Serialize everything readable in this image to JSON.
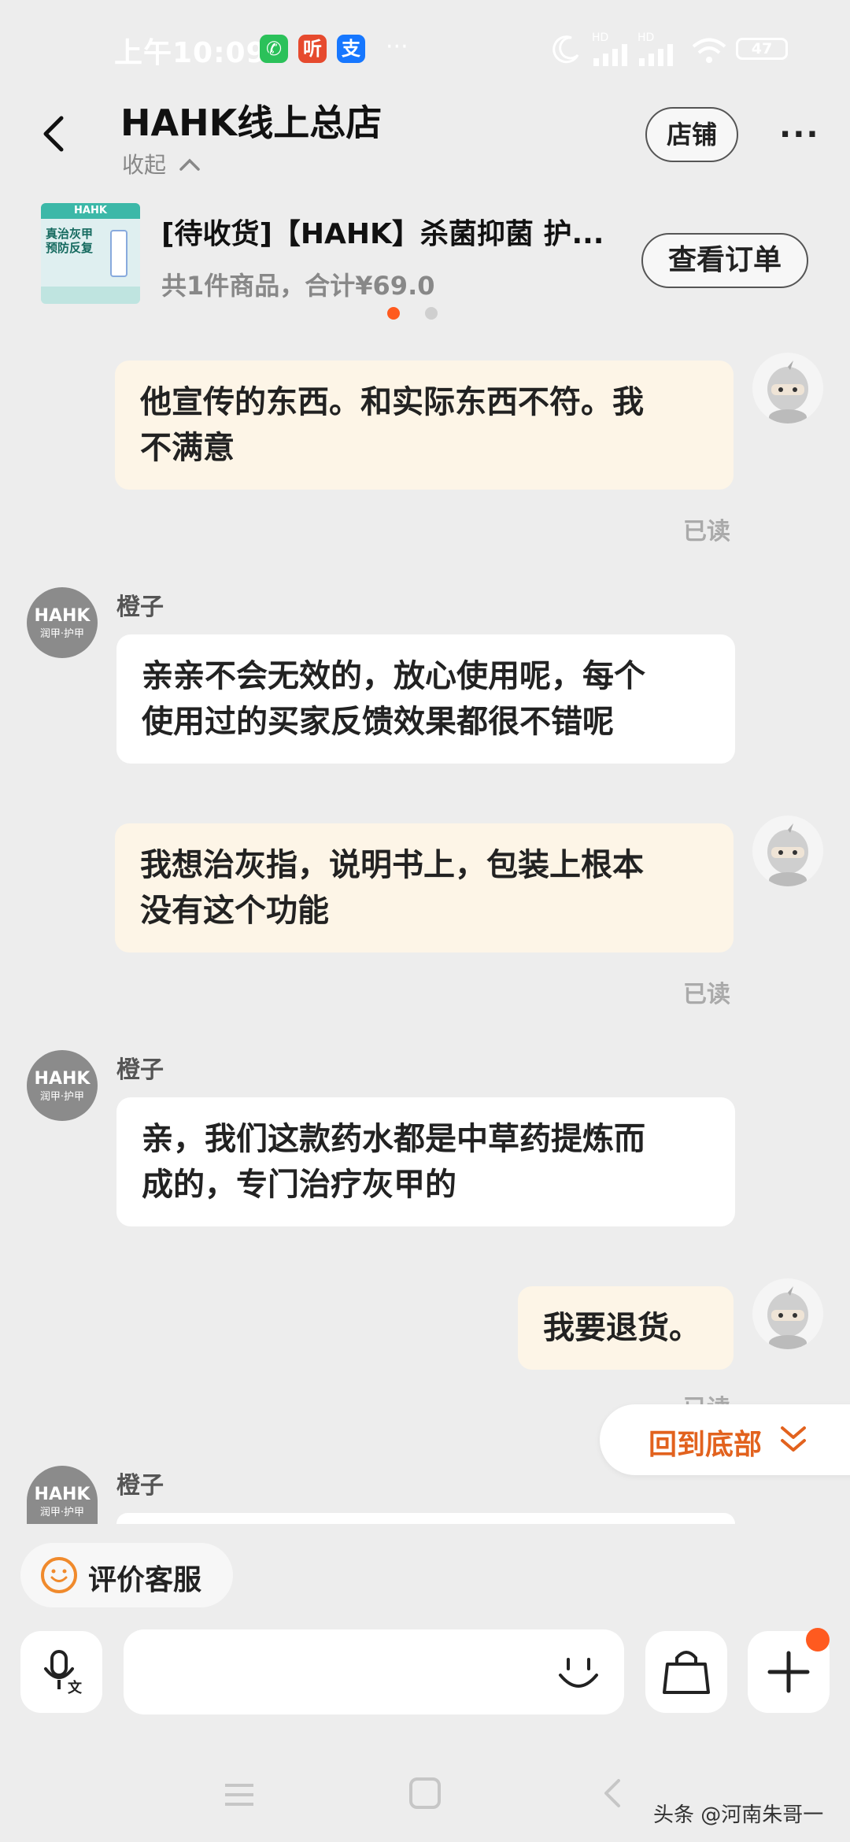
{
  "status_bar": {
    "time": "上午10:09",
    "apps": [
      {
        "name": "wechat",
        "glyph": "✆",
        "color": "#2bc15a"
      },
      {
        "name": "ting",
        "glyph": "听",
        "color": "#e64a2e"
      },
      {
        "name": "alipay",
        "glyph": "支",
        "color": "#1677ff"
      }
    ],
    "more": "···",
    "signal_1": "HD",
    "signal_2": "HD",
    "battery": "47"
  },
  "header": {
    "title": "HAHK线上总店",
    "collapse_label": "收起",
    "shop_button": "店铺",
    "more_icon": "···"
  },
  "order_card": {
    "thumb_brand": "HAHK",
    "thumb_line1": "真治灰甲",
    "thumb_line2": "预防反复",
    "title": "[待收货]【HAHK】杀菌抑菌 护...",
    "summary": "共1件商品，合计¥69.0",
    "view_button": "查看订单",
    "pager_active_color": "#ff5a1f",
    "pager_inactive_color": "#cfcfcf"
  },
  "messages": [
    {
      "from": "me",
      "text_line1": "他宣传的东西。和实际东西不符。我",
      "text_line2": "不满意",
      "read": "已读"
    },
    {
      "from": "them",
      "sender": "橙子",
      "avatar_line1": "HAHK",
      "avatar_line2": "润甲·护甲",
      "text_line1": "亲亲不会无效的，放心使用呢，每个",
      "text_line2": "使用过的买家反馈效果都很不错呢"
    },
    {
      "from": "me",
      "text_line1": "我想治灰指，说明书上，包装上根本",
      "text_line2": "没有这个功能",
      "read": "已读"
    },
    {
      "from": "them",
      "sender": "橙子",
      "avatar_line1": "HAHK",
      "avatar_line2": "润甲·护甲",
      "text_line1": "亲，我们这款药水都是中草药提炼而",
      "text_line2": "成的，专门治疗灰甲的"
    },
    {
      "from": "me",
      "text_line1": "我要退货。",
      "read": "已读"
    },
    {
      "from": "them",
      "sender": "橙子",
      "avatar_line1": "HAHK",
      "avatar_line2": "润甲·护甲"
    }
  ],
  "back_to_bottom": {
    "label": "回到底部",
    "icon": "double-chevron-down-icon",
    "color": "#e2621e"
  },
  "rate_service": {
    "label": "评价客服",
    "icon": "smile-icon"
  },
  "input_bar": {
    "placeholder": ""
  },
  "watermark": "头条 @河南朱哥一"
}
